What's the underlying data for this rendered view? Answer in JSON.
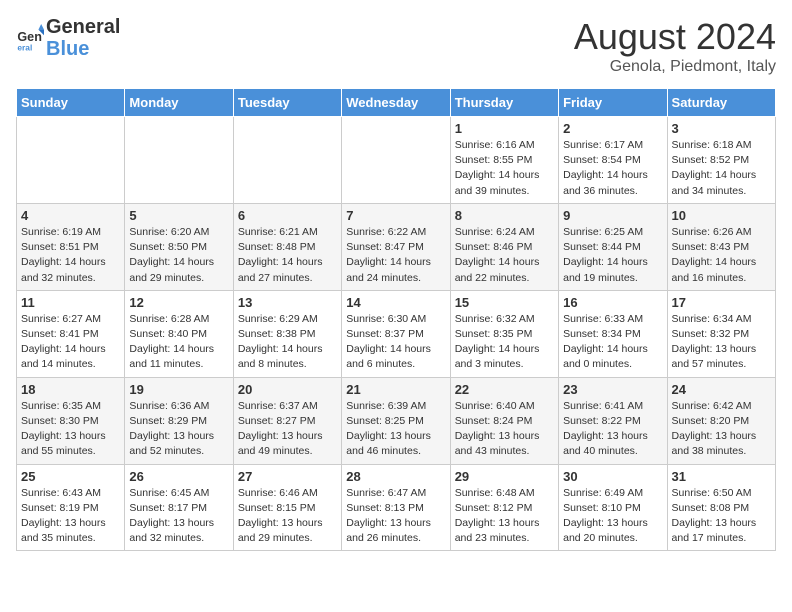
{
  "header": {
    "logo_general": "General",
    "logo_blue": "Blue",
    "month_title": "August 2024",
    "location": "Genola, Piedmont, Italy"
  },
  "weekdays": [
    "Sunday",
    "Monday",
    "Tuesday",
    "Wednesday",
    "Thursday",
    "Friday",
    "Saturday"
  ],
  "weeks": [
    [
      null,
      null,
      null,
      null,
      {
        "day": "1",
        "sunrise": "Sunrise: 6:16 AM",
        "sunset": "Sunset: 8:55 PM",
        "daylight": "Daylight: 14 hours and 39 minutes."
      },
      {
        "day": "2",
        "sunrise": "Sunrise: 6:17 AM",
        "sunset": "Sunset: 8:54 PM",
        "daylight": "Daylight: 14 hours and 36 minutes."
      },
      {
        "day": "3",
        "sunrise": "Sunrise: 6:18 AM",
        "sunset": "Sunset: 8:52 PM",
        "daylight": "Daylight: 14 hours and 34 minutes."
      }
    ],
    [
      {
        "day": "4",
        "sunrise": "Sunrise: 6:19 AM",
        "sunset": "Sunset: 8:51 PM",
        "daylight": "Daylight: 14 hours and 32 minutes."
      },
      {
        "day": "5",
        "sunrise": "Sunrise: 6:20 AM",
        "sunset": "Sunset: 8:50 PM",
        "daylight": "Daylight: 14 hours and 29 minutes."
      },
      {
        "day": "6",
        "sunrise": "Sunrise: 6:21 AM",
        "sunset": "Sunset: 8:48 PM",
        "daylight": "Daylight: 14 hours and 27 minutes."
      },
      {
        "day": "7",
        "sunrise": "Sunrise: 6:22 AM",
        "sunset": "Sunset: 8:47 PM",
        "daylight": "Daylight: 14 hours and 24 minutes."
      },
      {
        "day": "8",
        "sunrise": "Sunrise: 6:24 AM",
        "sunset": "Sunset: 8:46 PM",
        "daylight": "Daylight: 14 hours and 22 minutes."
      },
      {
        "day": "9",
        "sunrise": "Sunrise: 6:25 AM",
        "sunset": "Sunset: 8:44 PM",
        "daylight": "Daylight: 14 hours and 19 minutes."
      },
      {
        "day": "10",
        "sunrise": "Sunrise: 6:26 AM",
        "sunset": "Sunset: 8:43 PM",
        "daylight": "Daylight: 14 hours and 16 minutes."
      }
    ],
    [
      {
        "day": "11",
        "sunrise": "Sunrise: 6:27 AM",
        "sunset": "Sunset: 8:41 PM",
        "daylight": "Daylight: 14 hours and 14 minutes."
      },
      {
        "day": "12",
        "sunrise": "Sunrise: 6:28 AM",
        "sunset": "Sunset: 8:40 PM",
        "daylight": "Daylight: 14 hours and 11 minutes."
      },
      {
        "day": "13",
        "sunrise": "Sunrise: 6:29 AM",
        "sunset": "Sunset: 8:38 PM",
        "daylight": "Daylight: 14 hours and 8 minutes."
      },
      {
        "day": "14",
        "sunrise": "Sunrise: 6:30 AM",
        "sunset": "Sunset: 8:37 PM",
        "daylight": "Daylight: 14 hours and 6 minutes."
      },
      {
        "day": "15",
        "sunrise": "Sunrise: 6:32 AM",
        "sunset": "Sunset: 8:35 PM",
        "daylight": "Daylight: 14 hours and 3 minutes."
      },
      {
        "day": "16",
        "sunrise": "Sunrise: 6:33 AM",
        "sunset": "Sunset: 8:34 PM",
        "daylight": "Daylight: 14 hours and 0 minutes."
      },
      {
        "day": "17",
        "sunrise": "Sunrise: 6:34 AM",
        "sunset": "Sunset: 8:32 PM",
        "daylight": "Daylight: 13 hours and 57 minutes."
      }
    ],
    [
      {
        "day": "18",
        "sunrise": "Sunrise: 6:35 AM",
        "sunset": "Sunset: 8:30 PM",
        "daylight": "Daylight: 13 hours and 55 minutes."
      },
      {
        "day": "19",
        "sunrise": "Sunrise: 6:36 AM",
        "sunset": "Sunset: 8:29 PM",
        "daylight": "Daylight: 13 hours and 52 minutes."
      },
      {
        "day": "20",
        "sunrise": "Sunrise: 6:37 AM",
        "sunset": "Sunset: 8:27 PM",
        "daylight": "Daylight: 13 hours and 49 minutes."
      },
      {
        "day": "21",
        "sunrise": "Sunrise: 6:39 AM",
        "sunset": "Sunset: 8:25 PM",
        "daylight": "Daylight: 13 hours and 46 minutes."
      },
      {
        "day": "22",
        "sunrise": "Sunrise: 6:40 AM",
        "sunset": "Sunset: 8:24 PM",
        "daylight": "Daylight: 13 hours and 43 minutes."
      },
      {
        "day": "23",
        "sunrise": "Sunrise: 6:41 AM",
        "sunset": "Sunset: 8:22 PM",
        "daylight": "Daylight: 13 hours and 40 minutes."
      },
      {
        "day": "24",
        "sunrise": "Sunrise: 6:42 AM",
        "sunset": "Sunset: 8:20 PM",
        "daylight": "Daylight: 13 hours and 38 minutes."
      }
    ],
    [
      {
        "day": "25",
        "sunrise": "Sunrise: 6:43 AM",
        "sunset": "Sunset: 8:19 PM",
        "daylight": "Daylight: 13 hours and 35 minutes."
      },
      {
        "day": "26",
        "sunrise": "Sunrise: 6:45 AM",
        "sunset": "Sunset: 8:17 PM",
        "daylight": "Daylight: 13 hours and 32 minutes."
      },
      {
        "day": "27",
        "sunrise": "Sunrise: 6:46 AM",
        "sunset": "Sunset: 8:15 PM",
        "daylight": "Daylight: 13 hours and 29 minutes."
      },
      {
        "day": "28",
        "sunrise": "Sunrise: 6:47 AM",
        "sunset": "Sunset: 8:13 PM",
        "daylight": "Daylight: 13 hours and 26 minutes."
      },
      {
        "day": "29",
        "sunrise": "Sunrise: 6:48 AM",
        "sunset": "Sunset: 8:12 PM",
        "daylight": "Daylight: 13 hours and 23 minutes."
      },
      {
        "day": "30",
        "sunrise": "Sunrise: 6:49 AM",
        "sunset": "Sunset: 8:10 PM",
        "daylight": "Daylight: 13 hours and 20 minutes."
      },
      {
        "day": "31",
        "sunrise": "Sunrise: 6:50 AM",
        "sunset": "Sunset: 8:08 PM",
        "daylight": "Daylight: 13 hours and 17 minutes."
      }
    ]
  ]
}
